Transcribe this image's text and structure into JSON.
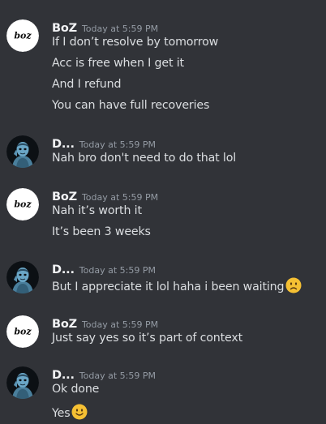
{
  "messages": [
    {
      "author": "BoZ",
      "avatar": "boz",
      "avatar_text": "boz",
      "time": "Today at 5:59 PM",
      "lines": [
        {
          "text": "If I don’t resolve by tomorrow"
        },
        {
          "text": "Acc is free when I get it"
        },
        {
          "text": "And I refund"
        },
        {
          "text": "You can have full recoveries"
        }
      ]
    },
    {
      "author": "D...",
      "avatar": "dark-figure",
      "time": "Today at 5:59 PM",
      "lines": [
        {
          "text": "Nah bro don't need to do that lol"
        }
      ]
    },
    {
      "author": "BoZ",
      "avatar": "boz",
      "avatar_text": "boz",
      "time": "Today at 5:59 PM",
      "lines": [
        {
          "text": "Nah it’s worth it"
        },
        {
          "text": "It’s been 3 weeks"
        }
      ]
    },
    {
      "author": "D...",
      "avatar": "dark-figure",
      "time": "Today at 5:59 PM",
      "lines": [
        {
          "text": "But I appreciate it lol haha i been waiting",
          "emoji": "frowning-face-emoji"
        }
      ]
    },
    {
      "author": "BoZ",
      "avatar": "boz",
      "avatar_text": "boz",
      "time": "Today at 5:59 PM",
      "lines": [
        {
          "text": "Just say yes so it’s part of context"
        }
      ]
    },
    {
      "author": "D...",
      "avatar": "dark-figure",
      "time": "Today at 5:59 PM",
      "lines": [
        {
          "text": "Ok done"
        },
        {
          "text": "Yes",
          "emoji": "slightly-smiling-face-emoji"
        }
      ]
    }
  ],
  "colors": {
    "background": "#313338",
    "author": "#f2f3f5",
    "timestamp": "#949ba4",
    "message_text": "#dbdee1",
    "emoji_face": "#f5c033"
  }
}
